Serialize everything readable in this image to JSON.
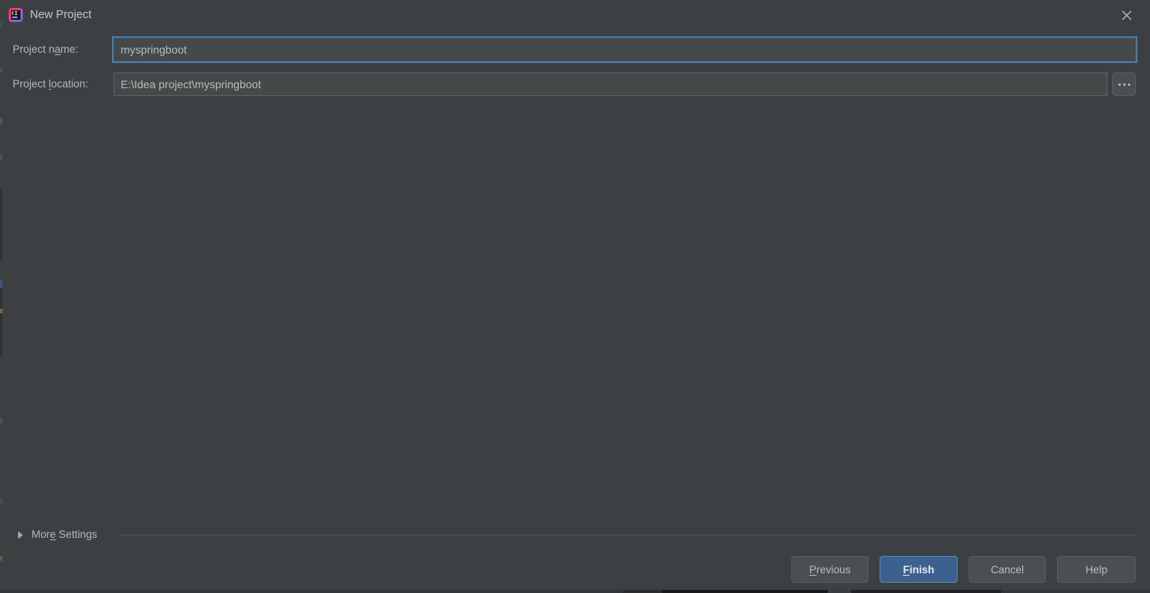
{
  "window": {
    "title": "New Project",
    "app_icon": "intellij-idea-icon",
    "close_icon": "close-icon",
    "background_color": "#3c4043"
  },
  "form": {
    "project_name": {
      "label_before": "Project n",
      "label_mnemonic": "a",
      "label_after": "me:",
      "label_full": "Project name:",
      "value": "myspringboot",
      "placeholder": "",
      "focused": true,
      "focus_color": "#4a7bab"
    },
    "project_location": {
      "label_before": "Project ",
      "label_mnemonic": "l",
      "label_after": "ocation:",
      "label_full": "Project location:",
      "value": "E:\\Idea project\\myspringboot",
      "placeholder": "",
      "focused": false,
      "browse_label": "...",
      "browse_icon": "ellipsis-icon"
    }
  },
  "more_settings": {
    "label_before": "Mor",
    "label_mnemonic": "e",
    "label_after": " Settings",
    "label_full": "More Settings",
    "expanded": false,
    "triangle_icon": "chevron-right-icon"
  },
  "footer": {
    "buttons": [
      {
        "name": "previous",
        "before": "",
        "mnemonic": "P",
        "after": "revious",
        "full": "Previous",
        "primary": false
      },
      {
        "name": "finish",
        "before": "",
        "mnemonic": "F",
        "after": "inish",
        "full": "Finish",
        "primary": true
      },
      {
        "name": "cancel",
        "before": "Cancel",
        "mnemonic": "",
        "after": "",
        "full": "Cancel",
        "primary": false
      },
      {
        "name": "help",
        "before": "Help",
        "mnemonic": "",
        "after": "",
        "full": "Help",
        "primary": false
      }
    ]
  },
  "colors": {
    "dialog_bg": "#3c4043",
    "input_bg": "#45494a",
    "input_border": "#5e6366",
    "focus_ring": "#4a7bab",
    "button_bg": "#4b4f51",
    "primary_button_bg": "#3d618f",
    "text": "#b6b8ba",
    "separator": "#4f5355"
  }
}
